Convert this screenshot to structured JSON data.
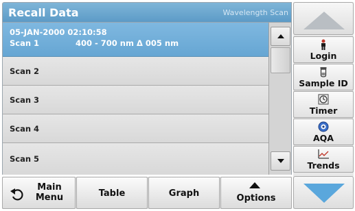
{
  "header": {
    "title": "Recall Data",
    "mode": "Wavelength Scan"
  },
  "list": {
    "items": [
      {
        "datetime": "05-JAN-2000  02:10:58",
        "name": "Scan 1",
        "range": "400 - 700 nm Δ 005 nm",
        "selected": true
      },
      {
        "name": "Scan 2"
      },
      {
        "name": "Scan 3"
      },
      {
        "name": "Scan 4"
      },
      {
        "name": "Scan 5"
      }
    ]
  },
  "sidebar": {
    "login": {
      "label": "Login",
      "icon": "person-icon"
    },
    "sample_id": {
      "label": "Sample ID",
      "icon": "sample-vial-icon"
    },
    "timer": {
      "label": "Timer",
      "icon": "timer-icon"
    },
    "aqa": {
      "label": "AQA",
      "icon": "aqa-icon"
    },
    "trends": {
      "label": "Trends",
      "icon": "trends-chart-icon"
    }
  },
  "toolbar": {
    "main_menu_line1": "Main",
    "main_menu_line2": "Menu",
    "table": "Table",
    "graph": "Graph",
    "options": "Options"
  },
  "colors": {
    "title_bar": "#6aa6cf",
    "selected_row": "#72afdb",
    "nav_down_arrow": "#5aa7dc",
    "nav_up_arrow": "#b9bec3"
  }
}
